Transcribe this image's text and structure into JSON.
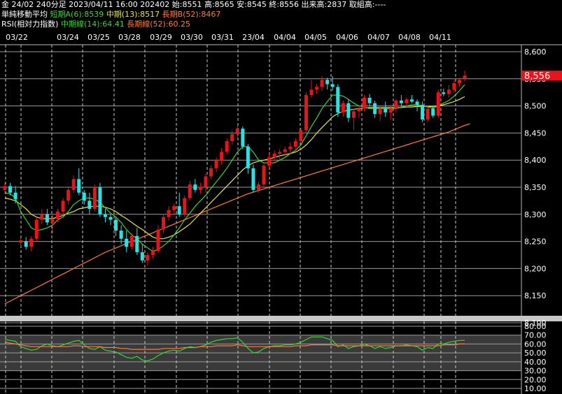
{
  "header": {
    "line1": "金 24/02 240分足 2023/04/11 16:00 202402 始:8551 高:8565 安:8545 終:8556 出来高:2837 取組高:----",
    "ma_title": "単純移動平均",
    "ma_short": "短期A(6):8539",
    "ma_mid": "中期(13):8517",
    "ma_long": "長期B(52):8467",
    "rsi_title": "RSI(相対力指数)",
    "rsi_mid": "中期線(14):64.41",
    "rsi_long": "長期線(52):60.25"
  },
  "colors": {
    "up": "#e8141c",
    "down": "#2fe0e0",
    "ma_short": "#37d437",
    "ma_mid": "#e6e63c",
    "ma_long": "#ff7b3a",
    "price_tag": "#e8141c"
  },
  "chart_data": [
    {
      "type": "candlestick",
      "x_labels": [
        "03/22",
        "03/24",
        "03/25",
        "03/28",
        "03/29",
        "03/30",
        "03/31",
        "23/04",
        "04/04",
        "04/05",
        "04/06",
        "04/07",
        "04/08",
        "04/11"
      ],
      "y_ticks": [
        "8,600",
        "8,550",
        "8,500",
        "8,450",
        "8,400",
        "8,350",
        "8,300",
        "8,250",
        "8,200",
        "8,150",
        "8,100"
      ],
      "ylim": [
        8100,
        8600
      ],
      "last_price_label": "8,556",
      "last_price": 8556,
      "candles": [
        [
          8345,
          8358,
          8338,
          8352
        ],
        [
          8352,
          8358,
          8335,
          8340
        ],
        [
          8340,
          8352,
          8320,
          8328
        ],
        [
          8248,
          8256,
          8240,
          8252
        ],
        [
          8250,
          8258,
          8235,
          8240
        ],
        [
          8240,
          8260,
          8232,
          8255
        ],
        [
          8255,
          8295,
          8250,
          8290
        ],
        [
          8290,
          8310,
          8282,
          8300
        ],
        [
          8300,
          8310,
          8280,
          8285
        ],
        [
          8285,
          8300,
          8265,
          8292
        ],
        [
          8292,
          8310,
          8285,
          8305
        ],
        [
          8305,
          8330,
          8298,
          8325
        ],
        [
          8325,
          8350,
          8318,
          8345
        ],
        [
          8345,
          8372,
          8340,
          8365
        ],
        [
          8365,
          8385,
          8335,
          8340
        ],
        [
          8340,
          8345,
          8318,
          8325
        ],
        [
          8325,
          8340,
          8300,
          8310
        ],
        [
          8310,
          8355,
          8305,
          8350
        ],
        [
          8350,
          8358,
          8295,
          8300
        ],
        [
          8300,
          8310,
          8285,
          8295
        ],
        [
          8295,
          8300,
          8280,
          8290
        ],
        [
          8290,
          8295,
          8260,
          8270
        ],
        [
          8270,
          8280,
          8245,
          8255
        ],
        [
          8255,
          8270,
          8230,
          8240
        ],
        [
          8240,
          8265,
          8235,
          8260
        ],
        [
          8260,
          8275,
          8225,
          8230
        ],
        [
          8230,
          8245,
          8210,
          8215
        ],
        [
          8215,
          8230,
          8205,
          8225
        ],
        [
          8225,
          8240,
          8218,
          8232
        ],
        [
          8232,
          8280,
          8228,
          8272
        ],
        [
          8272,
          8300,
          8265,
          8295
        ],
        [
          8295,
          8315,
          8288,
          8308
        ],
        [
          8308,
          8320,
          8298,
          8315
        ],
        [
          8315,
          8340,
          8295,
          8300
        ],
        [
          8300,
          8335,
          8295,
          8330
        ],
        [
          8330,
          8362,
          8325,
          8355
        ],
        [
          8355,
          8365,
          8340,
          8345
        ],
        [
          8345,
          8358,
          8338,
          8350
        ],
        [
          8350,
          8375,
          8340,
          8370
        ],
        [
          8370,
          8390,
          8365,
          8385
        ],
        [
          8385,
          8405,
          8378,
          8400
        ],
        [
          8400,
          8422,
          8392,
          8415
        ],
        [
          8415,
          8440,
          8410,
          8435
        ],
        [
          8435,
          8455,
          8428,
          8448
        ],
        [
          8448,
          8465,
          8440,
          8458
        ],
        [
          8458,
          8462,
          8420,
          8425
        ],
        [
          8425,
          8430,
          8375,
          8385
        ],
        [
          8385,
          8392,
          8340,
          8345
        ],
        [
          8345,
          8360,
          8340,
          8355
        ],
        [
          8355,
          8395,
          8350,
          8390
        ],
        [
          8390,
          8412,
          8385,
          8405
        ],
        [
          8405,
          8418,
          8395,
          8412
        ],
        [
          8412,
          8420,
          8400,
          8415
        ],
        [
          8415,
          8425,
          8405,
          8420
        ],
        [
          8420,
          8432,
          8412,
          8425
        ],
        [
          8425,
          8440,
          8418,
          8435
        ],
        [
          8435,
          8460,
          8430,
          8455
        ],
        [
          8455,
          8525,
          8450,
          8520
        ],
        [
          8520,
          8548,
          8515,
          8530
        ],
        [
          8530,
          8540,
          8522,
          8535
        ],
        [
          8535,
          8555,
          8528,
          8548
        ],
        [
          8548,
          8552,
          8530,
          8540
        ],
        [
          8540,
          8555,
          8528,
          8535
        ],
        [
          8535,
          8540,
          8480,
          8488
        ],
        [
          8488,
          8510,
          8480,
          8505
        ],
        [
          8505,
          8512,
          8470,
          8478
        ],
        [
          8478,
          8495,
          8455,
          8490
        ],
        [
          8490,
          8500,
          8478,
          8495
        ],
        [
          8495,
          8520,
          8490,
          8515
        ],
        [
          8515,
          8522,
          8500,
          8505
        ],
        [
          8505,
          8510,
          8478,
          8485
        ],
        [
          8485,
          8500,
          8472,
          8495
        ],
        [
          8495,
          8508,
          8480,
          8488
        ],
        [
          8488,
          8502,
          8475,
          8495
        ],
        [
          8495,
          8512,
          8488,
          8510
        ],
        [
          8510,
          8520,
          8500,
          8505
        ],
        [
          8505,
          8515,
          8498,
          8512
        ],
        [
          8512,
          8520,
          8505,
          8508
        ],
        [
          8508,
          8512,
          8490,
          8502
        ],
        [
          8502,
          8508,
          8470,
          8475
        ],
        [
          8475,
          8500,
          8470,
          8495
        ],
        [
          8495,
          8500,
          8478,
          8482
        ],
        [
          8482,
          8530,
          8478,
          8525
        ],
        [
          8525,
          8532,
          8518,
          8522
        ],
        [
          8522,
          8538,
          8515,
          8530
        ],
        [
          8530,
          8548,
          8525,
          8542
        ],
        [
          8542,
          8552,
          8535,
          8548
        ],
        [
          8551,
          8565,
          8545,
          8556
        ]
      ],
      "ma_short": [
        8340,
        8338,
        8330,
        8305,
        8290,
        8275,
        8270,
        8272,
        8275,
        8280,
        8290,
        8295,
        8305,
        8318,
        8325,
        8330,
        8330,
        8328,
        8322,
        8312,
        8302,
        8295,
        8285,
        8272,
        8262,
        8255,
        8245,
        8238,
        8232,
        8235,
        8242,
        8250,
        8262,
        8275,
        8290,
        8302,
        8315,
        8325,
        8335,
        8348,
        8360,
        8372,
        8385,
        8400,
        8415,
        8425,
        8425,
        8415,
        8400,
        8395,
        8395,
        8395,
        8400,
        8405,
        8412,
        8418,
        8428,
        8445,
        8462,
        8478,
        8495,
        8508,
        8520,
        8520,
        8518,
        8512,
        8505,
        8500,
        8498,
        8495,
        8495,
        8495,
        8495,
        8495,
        8495,
        8498,
        8500,
        8502,
        8502,
        8500,
        8498,
        8496,
        8500,
        8505,
        8510,
        8518,
        8528,
        8539
      ],
      "ma_mid": [
        8330,
        8328,
        8325,
        8318,
        8310,
        8300,
        8295,
        8292,
        8292,
        8292,
        8295,
        8298,
        8302,
        8305,
        8310,
        8312,
        8314,
        8315,
        8315,
        8313,
        8310,
        8305,
        8298,
        8292,
        8285,
        8278,
        8272,
        8265,
        8258,
        8255,
        8255,
        8258,
        8262,
        8268,
        8275,
        8282,
        8292,
        8302,
        8312,
        8322,
        8332,
        8342,
        8352,
        8362,
        8372,
        8382,
        8390,
        8395,
        8398,
        8400,
        8402,
        8405,
        8408,
        8410,
        8412,
        8415,
        8420,
        8428,
        8438,
        8450,
        8460,
        8470,
        8480,
        8486,
        8490,
        8492,
        8494,
        8495,
        8496,
        8497,
        8497,
        8497,
        8497,
        8497,
        8497,
        8497,
        8498,
        8498,
        8499,
        8499,
        8499,
        8499,
        8500,
        8502,
        8505,
        8508,
        8512,
        8517
      ],
      "ma_long": [
        8135,
        8140,
        8145,
        8150,
        8155,
        8160,
        8165,
        8170,
        8175,
        8180,
        8185,
        8190,
        8195,
        8200,
        8205,
        8210,
        8215,
        8220,
        8225,
        8230,
        8234,
        8238,
        8242,
        8246,
        8250,
        8254,
        8258,
        8262,
        8266,
        8270,
        8274,
        8278,
        8282,
        8286,
        8290,
        8294,
        8298,
        8302,
        8306,
        8310,
        8314,
        8318,
        8322,
        8326,
        8330,
        8334,
        8338,
        8341,
        8344,
        8347,
        8350,
        8353,
        8356,
        8359,
        8362,
        8365,
        8368,
        8371,
        8374,
        8377,
        8380,
        8383,
        8386,
        8389,
        8392,
        8395,
        8398,
        8401,
        8404,
        8407,
        8410,
        8413,
        8416,
        8419,
        8422,
        8425,
        8428,
        8431,
        8434,
        8437,
        8440,
        8443,
        8446,
        8449,
        8452,
        8456,
        8460,
        8464,
        8467
      ]
    },
    {
      "type": "line",
      "title": "RSI",
      "y_ticks": [
        "80.00",
        "70.00",
        "60.00",
        "50.00",
        "40.00",
        "30.00",
        "20.00",
        "10.00"
      ],
      "ylim": [
        10,
        80
      ],
      "series": [
        {
          "name": "中期線(14)",
          "color": "#37d437",
          "values": [
            65,
            64,
            63,
            57,
            55,
            53,
            54,
            58,
            60,
            58,
            57,
            59,
            61,
            63,
            64,
            59,
            55,
            54,
            57,
            53,
            52,
            51,
            48,
            45,
            44,
            46,
            42,
            41,
            43,
            47,
            50,
            52,
            53,
            52,
            55,
            57,
            56,
            57,
            59,
            62,
            64,
            65,
            66,
            66,
            67,
            62,
            55,
            50,
            51,
            55,
            57,
            58,
            58,
            59,
            59,
            60,
            62,
            65,
            68,
            68,
            68,
            66,
            64,
            57,
            59,
            55,
            57,
            58,
            60,
            58,
            55,
            57,
            55,
            56,
            58,
            58,
            59,
            58,
            57,
            53,
            56,
            55,
            60,
            60,
            62,
            63,
            64,
            64
          ]
        },
        {
          "name": "長期線(52)",
          "color": "#ff7b3a",
          "values": [
            62,
            61,
            60,
            59,
            58,
            57,
            57,
            57,
            57,
            57,
            57,
            57,
            57,
            58,
            58,
            57,
            57,
            57,
            57,
            56,
            56,
            56,
            55,
            55,
            54,
            54,
            54,
            54,
            54,
            54,
            55,
            55,
            55,
            55,
            56,
            56,
            56,
            57,
            57,
            57,
            58,
            58,
            58,
            58,
            59,
            58,
            57,
            57,
            57,
            57,
            57,
            57,
            57,
            57,
            57,
            58,
            58,
            58,
            59,
            59,
            59,
            59,
            59,
            58,
            58,
            58,
            58,
            58,
            58,
            58,
            58,
            58,
            58,
            58,
            58,
            58,
            58,
            58,
            58,
            58,
            58,
            58,
            58,
            59,
            59,
            59,
            60,
            60
          ]
        }
      ]
    }
  ]
}
